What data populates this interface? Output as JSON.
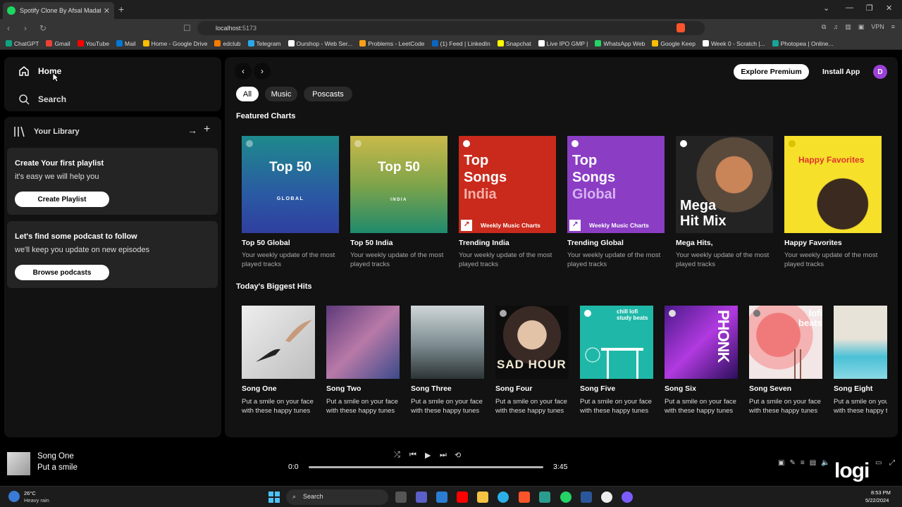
{
  "browser": {
    "tab_title": "Spotify Clone By Afsal Madathil",
    "new_tab": "+",
    "url_host": "localhost",
    "url_port": ":5173",
    "vpn": "VPN",
    "bookmarks": [
      {
        "label": "ChatGPT",
        "color": "#10a37f"
      },
      {
        "label": "Gmail",
        "color": "#ea4335"
      },
      {
        "label": "YouTube",
        "color": "#ff0000"
      },
      {
        "label": "Mail",
        "color": "#0078d4"
      },
      {
        "label": "Home - Google Drive",
        "color": "#fbbc04"
      },
      {
        "label": "edclub",
        "color": "#f57c00"
      },
      {
        "label": "Telegram",
        "color": "#29a9eb"
      },
      {
        "label": "Ourshop - Web Ser...",
        "color": "#ffffff"
      },
      {
        "label": "Problems - LeetCode",
        "color": "#ffa116"
      },
      {
        "label": "(1) Feed | LinkedIn",
        "color": "#0a66c2"
      },
      {
        "label": "Snapchat",
        "color": "#fffc00"
      },
      {
        "label": "Live IPO GMP |",
        "color": "#ffffff"
      },
      {
        "label": "WhatsApp Web",
        "color": "#25d366"
      },
      {
        "label": "Google Keep",
        "color": "#fbbc04"
      },
      {
        "label": "Week 0 - Scratch |...",
        "color": "#ffffff"
      },
      {
        "label": "Photopea | Online...",
        "color": "#18a497"
      }
    ]
  },
  "sidebar": {
    "home_label": "Home",
    "search_label": "Search",
    "library_label": "Your Library",
    "playlist_card": {
      "title": "Create Your first playlist",
      "subtitle": "it's easy we will help you",
      "button": "Create Playlist"
    },
    "podcast_card": {
      "title": "Let's find some podcast to follow",
      "subtitle": "we'll keep you update on new episodes",
      "button": "Browse podcasts"
    }
  },
  "header": {
    "explore_premium": "Explore Premium",
    "install_app": "Install App",
    "avatar_letter": "D"
  },
  "filters": [
    "All",
    "Music",
    "Poscasts"
  ],
  "featured": {
    "title": "Featured Charts",
    "items": [
      {
        "name": "Top 50 Global",
        "desc": "Your weekly update of the most played tracks",
        "art_title": "Top 50",
        "art_sub": "GLOBAL"
      },
      {
        "name": "Top 50 India",
        "desc": "Your weekly update of the most played tracks",
        "art_title": "Top 50",
        "art_sub": "INDIA"
      },
      {
        "name": "Trending India",
        "desc": "Your weekly update of the most played tracks",
        "art_line1": "Top",
        "art_line2": "Songs",
        "art_line3": "India",
        "art_foot": "Weekly Music Charts"
      },
      {
        "name": "Trending Global",
        "desc": "Your weekly update of the most played tracks",
        "art_line1": "Top",
        "art_line2": "Songs",
        "art_line3": "Global",
        "art_foot": "Weekly Music Charts"
      },
      {
        "name": "Mega Hits,",
        "desc": "Your weekly update of the most played tracks",
        "art_line1": "Mega",
        "art_line2": "Hit Mix"
      },
      {
        "name": "Happy Favorites",
        "desc": "Your weekly update of the most played tracks",
        "art_title": "Happy Favorites"
      }
    ]
  },
  "hits": {
    "title": "Today's Biggest Hits",
    "items": [
      {
        "name": "Song One",
        "desc": "Put a smile on your face with these happy tunes"
      },
      {
        "name": "Song Two",
        "desc": "Put a smile on your face with these happy tunes"
      },
      {
        "name": "Song Three",
        "desc": "Put a smile on your face with these happy tunes"
      },
      {
        "name": "Song Four",
        "desc": "Put a smile on your face with these happy tunes",
        "art_text": "SAD HOUR"
      },
      {
        "name": "Song Five",
        "desc": "Put a smile on your face with these happy tunes",
        "art_text": "chill lofi study beats"
      },
      {
        "name": "Song Six",
        "desc": "Put a smile on your face with these happy tunes",
        "art_text": "PHONK"
      },
      {
        "name": "Song Seven",
        "desc": "Put a smile on your face with these happy tunes",
        "art_text": "lofi beats"
      },
      {
        "name": "Song Eight",
        "desc": "Put a smile on your face with these happy tunes"
      }
    ]
  },
  "player": {
    "track_name": "Song One",
    "track_artist": "Put a smile",
    "current_time": "0:0",
    "duration": "3:45",
    "progress": 0.0
  },
  "taskbar": {
    "temp": "26°C",
    "weather": "Heavy rain",
    "search": "Search",
    "time": "8:53 PM",
    "date": "5/22/2024",
    "watermark": "logi"
  }
}
